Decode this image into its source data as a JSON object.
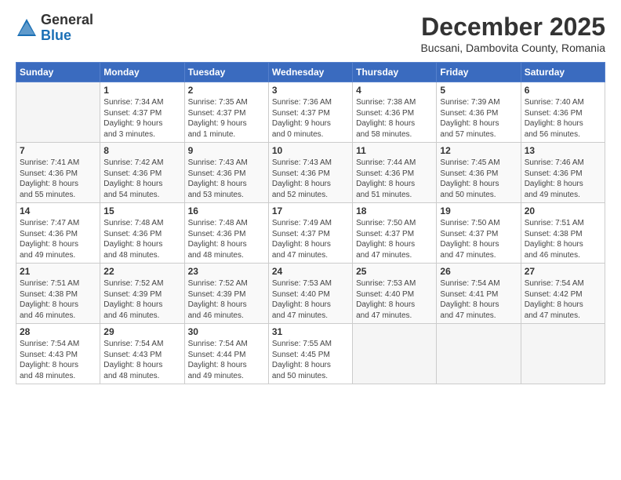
{
  "header": {
    "logo_general": "General",
    "logo_blue": "Blue",
    "month_title": "December 2025",
    "subtitle": "Bucsani, Dambovita County, Romania"
  },
  "days_of_week": [
    "Sunday",
    "Monday",
    "Tuesday",
    "Wednesday",
    "Thursday",
    "Friday",
    "Saturday"
  ],
  "weeks": [
    [
      {
        "day": "",
        "info": ""
      },
      {
        "day": "1",
        "info": "Sunrise: 7:34 AM\nSunset: 4:37 PM\nDaylight: 9 hours\nand 3 minutes."
      },
      {
        "day": "2",
        "info": "Sunrise: 7:35 AM\nSunset: 4:37 PM\nDaylight: 9 hours\nand 1 minute."
      },
      {
        "day": "3",
        "info": "Sunrise: 7:36 AM\nSunset: 4:37 PM\nDaylight: 9 hours\nand 0 minutes."
      },
      {
        "day": "4",
        "info": "Sunrise: 7:38 AM\nSunset: 4:36 PM\nDaylight: 8 hours\nand 58 minutes."
      },
      {
        "day": "5",
        "info": "Sunrise: 7:39 AM\nSunset: 4:36 PM\nDaylight: 8 hours\nand 57 minutes."
      },
      {
        "day": "6",
        "info": "Sunrise: 7:40 AM\nSunset: 4:36 PM\nDaylight: 8 hours\nand 56 minutes."
      }
    ],
    [
      {
        "day": "7",
        "info": "Sunrise: 7:41 AM\nSunset: 4:36 PM\nDaylight: 8 hours\nand 55 minutes."
      },
      {
        "day": "8",
        "info": "Sunrise: 7:42 AM\nSunset: 4:36 PM\nDaylight: 8 hours\nand 54 minutes."
      },
      {
        "day": "9",
        "info": "Sunrise: 7:43 AM\nSunset: 4:36 PM\nDaylight: 8 hours\nand 53 minutes."
      },
      {
        "day": "10",
        "info": "Sunrise: 7:43 AM\nSunset: 4:36 PM\nDaylight: 8 hours\nand 52 minutes."
      },
      {
        "day": "11",
        "info": "Sunrise: 7:44 AM\nSunset: 4:36 PM\nDaylight: 8 hours\nand 51 minutes."
      },
      {
        "day": "12",
        "info": "Sunrise: 7:45 AM\nSunset: 4:36 PM\nDaylight: 8 hours\nand 50 minutes."
      },
      {
        "day": "13",
        "info": "Sunrise: 7:46 AM\nSunset: 4:36 PM\nDaylight: 8 hours\nand 49 minutes."
      }
    ],
    [
      {
        "day": "14",
        "info": "Sunrise: 7:47 AM\nSunset: 4:36 PM\nDaylight: 8 hours\nand 49 minutes."
      },
      {
        "day": "15",
        "info": "Sunrise: 7:48 AM\nSunset: 4:36 PM\nDaylight: 8 hours\nand 48 minutes."
      },
      {
        "day": "16",
        "info": "Sunrise: 7:48 AM\nSunset: 4:36 PM\nDaylight: 8 hours\nand 48 minutes."
      },
      {
        "day": "17",
        "info": "Sunrise: 7:49 AM\nSunset: 4:37 PM\nDaylight: 8 hours\nand 47 minutes."
      },
      {
        "day": "18",
        "info": "Sunrise: 7:50 AM\nSunset: 4:37 PM\nDaylight: 8 hours\nand 47 minutes."
      },
      {
        "day": "19",
        "info": "Sunrise: 7:50 AM\nSunset: 4:37 PM\nDaylight: 8 hours\nand 47 minutes."
      },
      {
        "day": "20",
        "info": "Sunrise: 7:51 AM\nSunset: 4:38 PM\nDaylight: 8 hours\nand 46 minutes."
      }
    ],
    [
      {
        "day": "21",
        "info": "Sunrise: 7:51 AM\nSunset: 4:38 PM\nDaylight: 8 hours\nand 46 minutes."
      },
      {
        "day": "22",
        "info": "Sunrise: 7:52 AM\nSunset: 4:39 PM\nDaylight: 8 hours\nand 46 minutes."
      },
      {
        "day": "23",
        "info": "Sunrise: 7:52 AM\nSunset: 4:39 PM\nDaylight: 8 hours\nand 46 minutes."
      },
      {
        "day": "24",
        "info": "Sunrise: 7:53 AM\nSunset: 4:40 PM\nDaylight: 8 hours\nand 47 minutes."
      },
      {
        "day": "25",
        "info": "Sunrise: 7:53 AM\nSunset: 4:40 PM\nDaylight: 8 hours\nand 47 minutes."
      },
      {
        "day": "26",
        "info": "Sunrise: 7:54 AM\nSunset: 4:41 PM\nDaylight: 8 hours\nand 47 minutes."
      },
      {
        "day": "27",
        "info": "Sunrise: 7:54 AM\nSunset: 4:42 PM\nDaylight: 8 hours\nand 47 minutes."
      }
    ],
    [
      {
        "day": "28",
        "info": "Sunrise: 7:54 AM\nSunset: 4:43 PM\nDaylight: 8 hours\nand 48 minutes."
      },
      {
        "day": "29",
        "info": "Sunrise: 7:54 AM\nSunset: 4:43 PM\nDaylight: 8 hours\nand 48 minutes."
      },
      {
        "day": "30",
        "info": "Sunrise: 7:54 AM\nSunset: 4:44 PM\nDaylight: 8 hours\nand 49 minutes."
      },
      {
        "day": "31",
        "info": "Sunrise: 7:55 AM\nSunset: 4:45 PM\nDaylight: 8 hours\nand 50 minutes."
      },
      {
        "day": "",
        "info": ""
      },
      {
        "day": "",
        "info": ""
      },
      {
        "day": "",
        "info": ""
      }
    ]
  ]
}
